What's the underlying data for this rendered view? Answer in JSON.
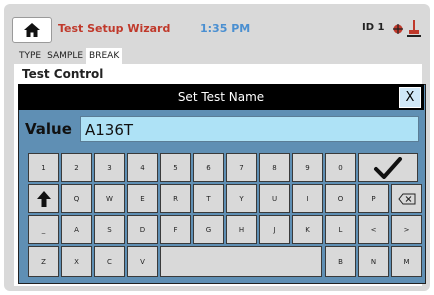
{
  "header": {
    "title": "Test Setup Wizard",
    "time": "1:35 PM",
    "id_label": "ID 1",
    "icons": {
      "home": "home-icon",
      "status": "status-icon",
      "probe": "probe-icon"
    }
  },
  "tabs": [
    "TYPE",
    "SAMPLE",
    "BREAK"
  ],
  "active_tab": "BREAK",
  "section_title": "Test Control",
  "dialog": {
    "title": "Set Test Name",
    "close_label": "X",
    "value_label": "Value",
    "value": "A136T"
  },
  "keyboard": {
    "row1": [
      "1",
      "2",
      "3",
      "4",
      "5",
      "6",
      "7",
      "8",
      "9",
      "0"
    ],
    "enter": "✔",
    "row2": [
      "Q",
      "W",
      "E",
      "R",
      "T",
      "Y",
      "U",
      "I",
      "O",
      "P"
    ],
    "shift": "🡅",
    "backspace": "⌫",
    "row3_left": "_",
    "row3": [
      "A",
      "S",
      "D",
      "F",
      "G",
      "H",
      "J",
      "K",
      "L",
      "<",
      ">"
    ],
    "row4_left": [
      "Z",
      "X",
      "C",
      "V"
    ],
    "row4_right": [
      "B",
      "N",
      "M"
    ]
  },
  "colors": {
    "title": "#c0392b",
    "clock": "#4a8fd1",
    "dialog": "#5f8fb4",
    "field": "#aee2f6"
  }
}
